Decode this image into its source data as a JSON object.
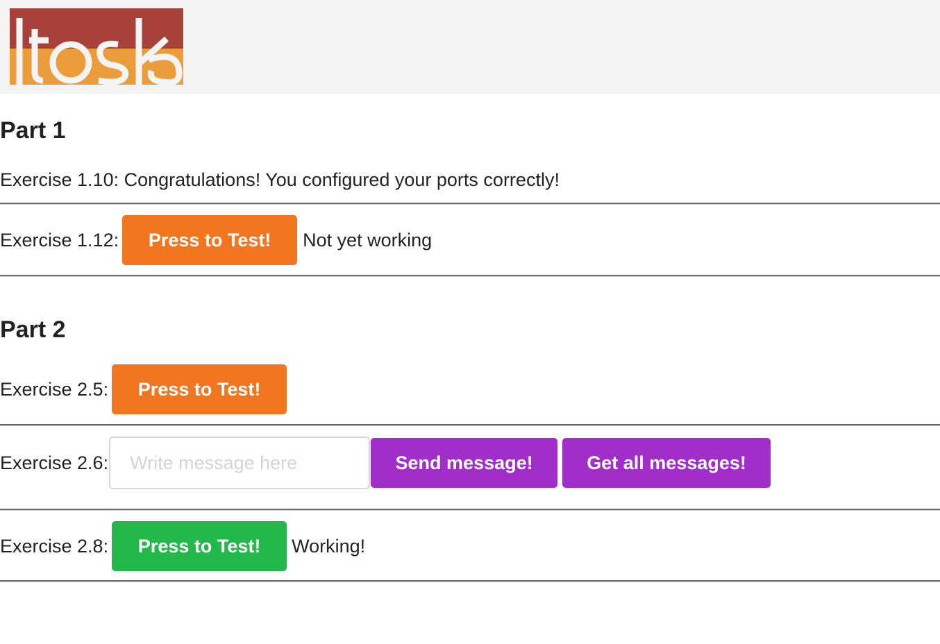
{
  "header": {
    "logo_text": "itoska"
  },
  "part1": {
    "title": "Part 1",
    "ex110": {
      "label": "Exercise 1.10: Congratulations! You configured your ports correctly!"
    },
    "ex112": {
      "label": "Exercise 1.12:",
      "button": "Press to Test!",
      "status": "Not yet working"
    }
  },
  "part2": {
    "title": "Part 2",
    "ex25": {
      "label": "Exercise 2.5:",
      "button": "Press to Test!"
    },
    "ex26": {
      "label": "Exercise 2.6:",
      "input_value": "",
      "input_placeholder": "Write message here",
      "send_button": "Send message!",
      "get_button": "Get all messages!"
    },
    "ex28": {
      "label": "Exercise 2.8:",
      "button": "Press to Test!",
      "status": "Working!"
    }
  },
  "colors": {
    "orange": "#f27620",
    "green": "#22b84a",
    "purple": "#a12ec9",
    "logo_top": "#a8413a",
    "logo_bottom": "#eb9d3c"
  }
}
